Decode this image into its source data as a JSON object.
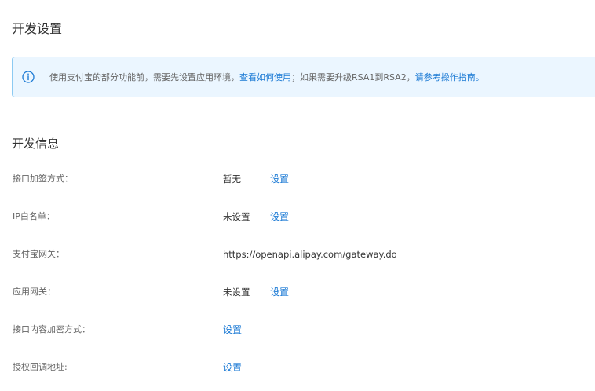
{
  "page": {
    "title": "开发设置"
  },
  "notice": {
    "icon": "info-icon",
    "accent_color": "#1a79d4",
    "text_before": "使用支付宝的部分功能前，需要先设置应用环境，",
    "link1": "查看如何使用",
    "text_middle": "；如果需要升级RSA1到RSA2，",
    "link2": "请参考操作指南。"
  },
  "dev_info": {
    "title": "开发信息",
    "rows": [
      {
        "label": "接口加签方式：",
        "value": "暂无",
        "action": "设置"
      },
      {
        "label": "IP白名单：",
        "value": "未设置",
        "action": "设置"
      },
      {
        "label": "支付宝网关：",
        "value": "https://openapi.alipay.com/gateway.do",
        "action": ""
      },
      {
        "label": "应用网关：",
        "value": "未设置",
        "action": "设置"
      },
      {
        "label": "接口内容加密方式：",
        "value": "",
        "action": "设置"
      },
      {
        "label": "授权回调地址:",
        "value": "",
        "action": "设置"
      }
    ]
  }
}
